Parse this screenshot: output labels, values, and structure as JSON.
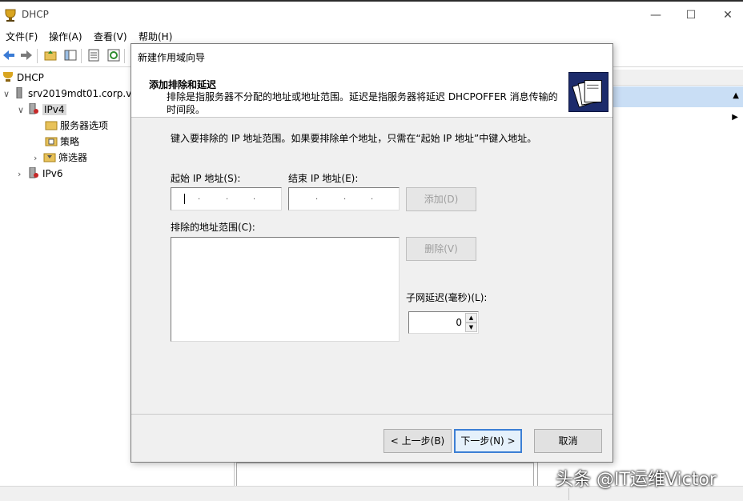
{
  "window": {
    "title": "DHCP",
    "controls": {
      "minimize": "—",
      "maximize": "☐",
      "close": "✕"
    }
  },
  "menu": [
    "文件(F)",
    "操作(A)",
    "查看(V)",
    "帮助(H)"
  ],
  "tree": {
    "root": "DHCP",
    "server": "srv2019mdt01.corp.v",
    "ipv4": "IPv4",
    "children": [
      "服务器选项",
      "策略",
      "筛选器"
    ],
    "ipv6": "IPv6"
  },
  "wizard": {
    "title": "新建作用域向导",
    "heading": "添加排除和延迟",
    "description": "排除是指服务器不分配的地址或地址范围。延迟是指服务器将延迟 DHCPOFFER 消息传输的时间段。",
    "instruction": "键入要排除的 IP 地址范围。如果要排除单个地址，只需在“起始 IP 地址”中键入地址。",
    "start_ip_label": "起始 IP 地址(S):",
    "end_ip_label": "结束 IP 地址(E):",
    "add_button": "添加(D)",
    "excluded_label": "排除的地址范围(C):",
    "remove_button": "删除(V)",
    "subnet_delay_label": "子网延迟(毫秒)(L):",
    "subnet_delay_value": "0",
    "back_button": "< 上一步(B)",
    "next_button": "下一步(N) >",
    "cancel_button": "取消"
  },
  "watermark": "头条 @IT运维Victor"
}
